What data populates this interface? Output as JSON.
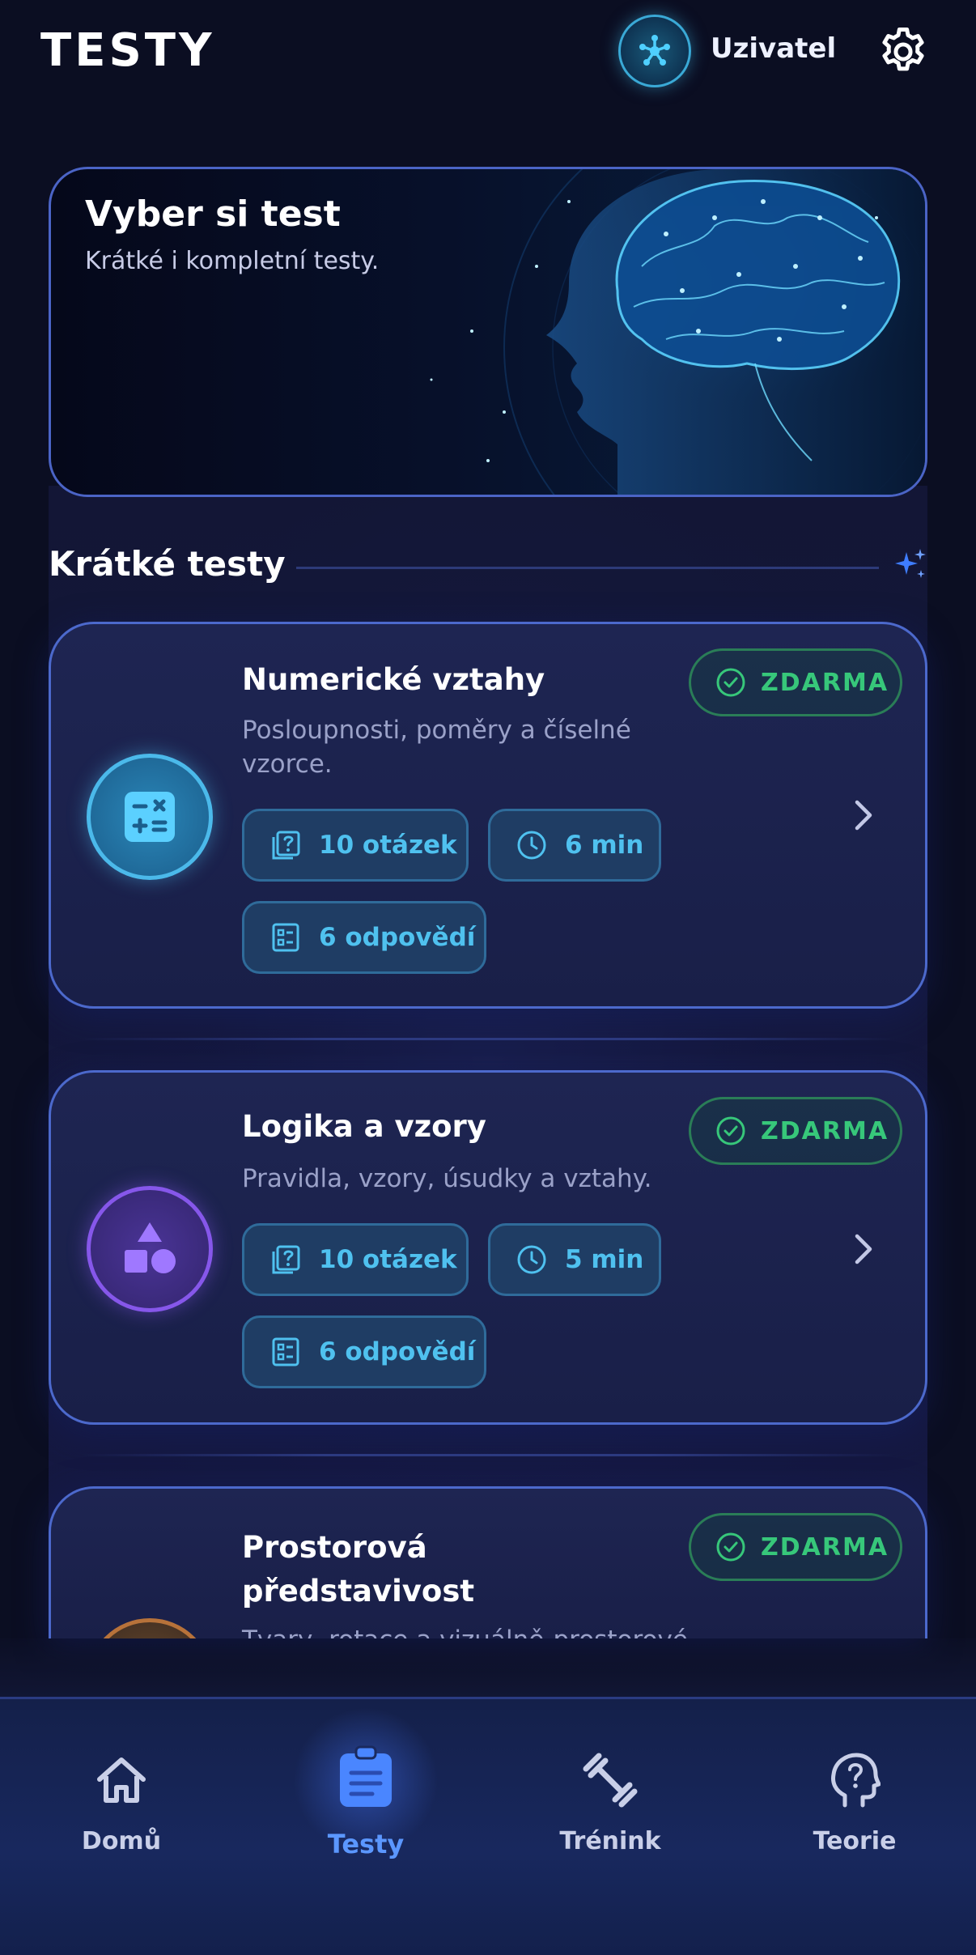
{
  "header": {
    "title": "TESTY",
    "user_name": "Uzivatel",
    "avatar_icon": "network-icon",
    "settings_icon": "gear-icon"
  },
  "hero": {
    "title": "Vyber si test",
    "subtitle": "Krátké i kompletní testy."
  },
  "section": {
    "title": "Krátké testy",
    "icon": "sparkle-icon"
  },
  "cards": [
    {
      "title": "Numerické vztahy",
      "description": "Posloupnosti, poměry a číselné vzorce.",
      "badge": "ZDARMA",
      "questions": "10 otázek",
      "time": "6 min",
      "answers": "6 odpovědí",
      "icon": "calculator-icon",
      "accent": "#4bb9ea"
    },
    {
      "title": "Logika a vzory",
      "description": "Pravidla, vzory, úsudky a vztahy.",
      "badge": "ZDARMA",
      "questions": "10 otázek",
      "time": "5 min",
      "answers": "6 odpovědí",
      "icon": "shapes-icon",
      "accent": "#8657ea"
    },
    {
      "title": "Prostorová představivost",
      "description": "Tvary, rotace a vizuálně-prostorové",
      "badge": "ZDARMA",
      "icon": "cube-icon",
      "accent": "#b7723a"
    }
  ],
  "nav": {
    "items": [
      {
        "label": "Domů",
        "icon": "home-icon"
      },
      {
        "label": "Testy",
        "icon": "clipboard-icon",
        "active": true
      },
      {
        "label": "Trénink",
        "icon": "dumbbell-icon"
      },
      {
        "label": "Teorie",
        "icon": "head-question-icon"
      }
    ]
  },
  "colors": {
    "background": "#0b0e22",
    "card_border": "#4c69cc",
    "free_green": "#37c77a",
    "chip_text": "#4fc1ef",
    "active_nav": "#5b97ff"
  }
}
